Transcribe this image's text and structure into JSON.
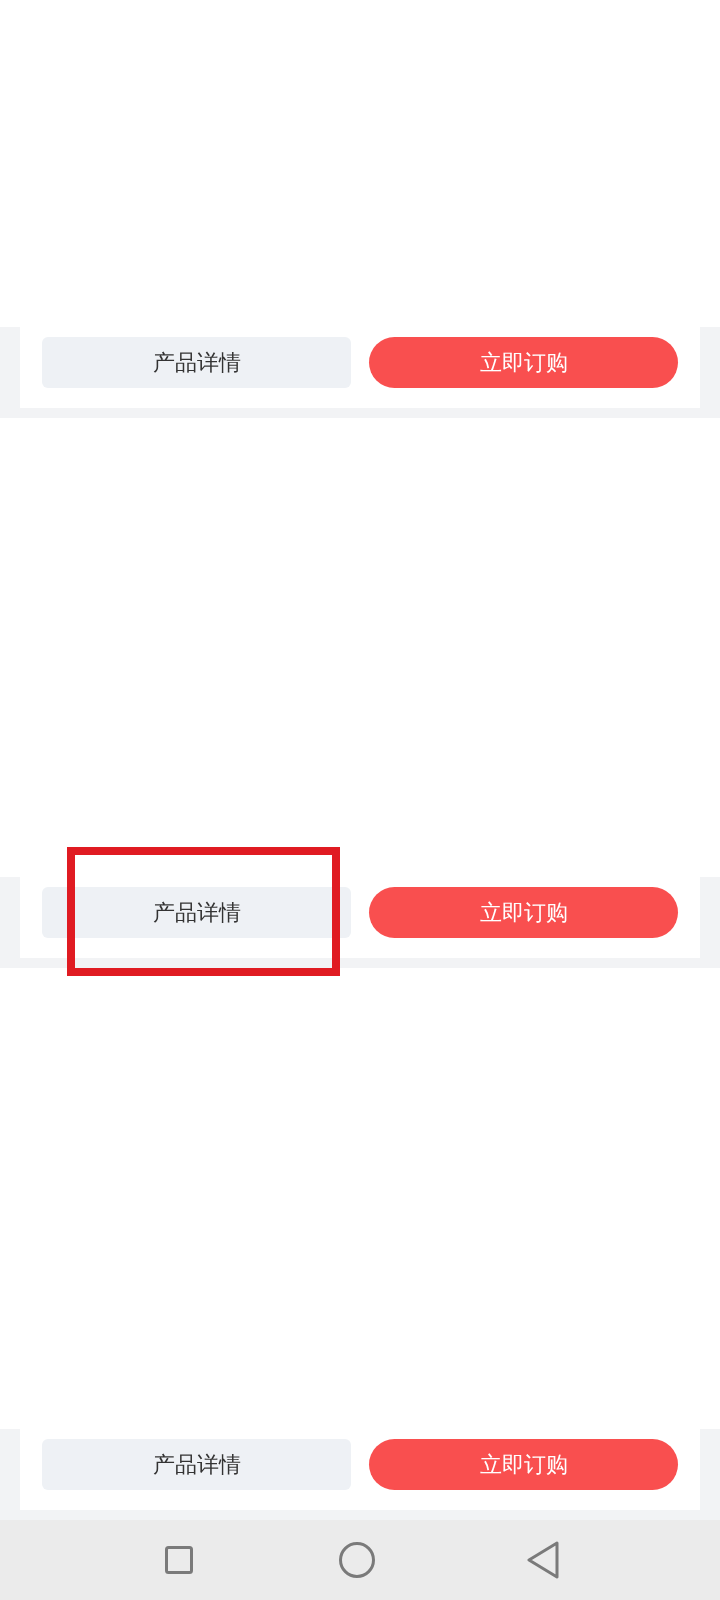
{
  "product_cards": [
    {
      "detail_button": "产品详情",
      "order_button": "立即订购",
      "highlighted": false
    },
    {
      "detail_button": "产品详情",
      "order_button": "立即订购",
      "highlighted": true
    },
    {
      "detail_button": "产品详情",
      "order_button": "立即订购",
      "highlighted": false
    }
  ]
}
